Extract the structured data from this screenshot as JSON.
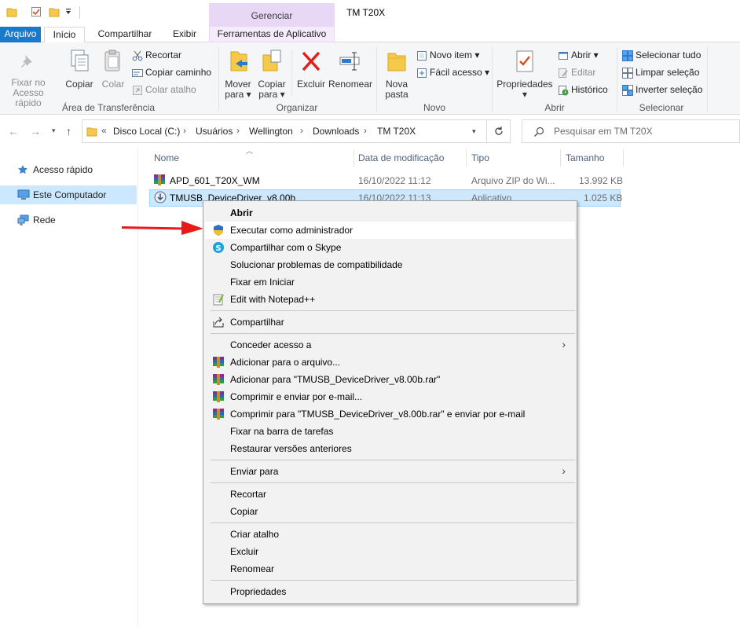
{
  "titlebar": {
    "contextual_group": "Gerenciar",
    "window_title": "TM T20X"
  },
  "tabs": {
    "file": "Arquivo",
    "home": "Início",
    "share": "Compartilhar",
    "view": "Exibir",
    "app_tools": "Ferramentas de Aplicativo"
  },
  "ribbon": {
    "clipboard": {
      "label": "Área de Transferência",
      "pin_line1": "Fixar no",
      "pin_line2": "Acesso rápido",
      "copy": "Copiar",
      "paste": "Colar",
      "cut": "Recortar",
      "copy_path": "Copiar caminho",
      "paste_shortcut": "Colar atalho"
    },
    "organize": {
      "label": "Organizar",
      "move_line1": "Mover",
      "move_line2": "para",
      "copyto_line1": "Copiar",
      "copyto_line2": "para",
      "delete": "Excluir",
      "rename": "Renomear"
    },
    "new": {
      "label": "Novo",
      "folder_line1": "Nova",
      "folder_line2": "pasta",
      "new_item": "Novo item",
      "easy_access": "Fácil acesso"
    },
    "open": {
      "label": "Abrir",
      "properties": "Propriedades",
      "open": "Abrir",
      "edit": "Editar",
      "history": "Histórico"
    },
    "select": {
      "label": "Selecionar",
      "select_all": "Selecionar tudo",
      "select_none": "Limpar seleção",
      "invert": "Inverter seleção"
    }
  },
  "address": {
    "prefix": "«",
    "crumbs": [
      "Disco Local (C:)",
      "Usuários",
      "Wellington",
      "Downloads",
      "TM T20X"
    ],
    "search_placeholder": "Pesquisar em TM T20X"
  },
  "navpane": {
    "items": [
      "Acesso rápido",
      "Este Computador",
      "Rede"
    ]
  },
  "filelist": {
    "columns": [
      "Nome",
      "Data de modificação",
      "Tipo",
      "Tamanho"
    ],
    "rows": [
      {
        "name": "APD_601_T20X_WM",
        "date": "16/10/2022 11:12",
        "type": "Arquivo ZIP do Wi...",
        "size": "13.992 KB"
      },
      {
        "name": "TMUSB_DeviceDriver_v8.00b",
        "date": "16/10/2022 11:13",
        "type": "Aplicativo",
        "size": "1.025 KB"
      }
    ]
  },
  "contextmenu": {
    "items": [
      "Abrir",
      "Executar como administrador",
      "Compartilhar com o Skype",
      "Solucionar problemas de compatibilidade",
      "Fixar em Iniciar",
      "Edit with Notepad++",
      "Compartilhar",
      "Conceder acesso a",
      "Adicionar para o arquivo...",
      "Adicionar para \"TMUSB_DeviceDriver_v8.00b.rar\"",
      "Comprimir e enviar por e-mail...",
      "Comprimir para \"TMUSB_DeviceDriver_v8.00b.rar\" e enviar por e-mail",
      "Fixar na barra de tarefas",
      "Restaurar versões anteriores",
      "Enviar para",
      "Recortar",
      "Copiar",
      "Criar atalho",
      "Excluir",
      "Renomear",
      "Propriedades"
    ]
  },
  "colors": {
    "accent": "#1979ca",
    "selection": "#cce8ff",
    "contextual_tab": "#e9d7f6",
    "annotation_arrow": "#e81b1b"
  }
}
